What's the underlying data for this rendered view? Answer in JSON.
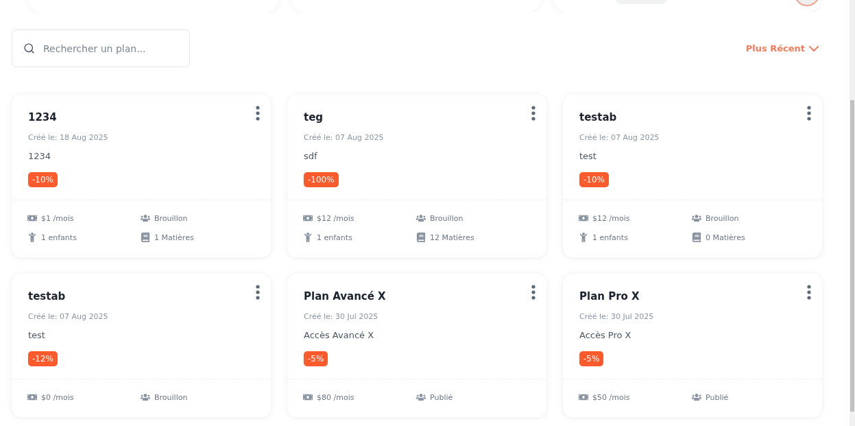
{
  "search": {
    "placeholder": "Rechercher un plan..."
  },
  "sort": {
    "label": "Plus Récent"
  },
  "plans": [
    {
      "title": "1234",
      "created": "Créé le: 18 Aug 2025",
      "description": "1234",
      "discount": "-10%",
      "stats": [
        {
          "kind": "price",
          "text": "$1 /mois"
        },
        {
          "kind": "status",
          "text": "Brouillon"
        },
        {
          "kind": "children",
          "text": "1 enfants"
        },
        {
          "kind": "subjects",
          "text": "1 Matières"
        }
      ]
    },
    {
      "title": "teg",
      "created": "Créé le: 07 Aug 2025",
      "description": "sdf",
      "discount": "-100%",
      "stats": [
        {
          "kind": "price",
          "text": "$12 /mois"
        },
        {
          "kind": "status",
          "text": "Brouillon"
        },
        {
          "kind": "children",
          "text": "1 enfants"
        },
        {
          "kind": "subjects",
          "text": "12 Matières"
        }
      ]
    },
    {
      "title": "testab",
      "created": "Créé le: 07 Aug 2025",
      "description": "test",
      "discount": "-10%",
      "stats": [
        {
          "kind": "price",
          "text": "$12 /mois"
        },
        {
          "kind": "status",
          "text": "Brouillon"
        },
        {
          "kind": "children",
          "text": "1 enfants"
        },
        {
          "kind": "subjects",
          "text": "0 Matières"
        }
      ]
    },
    {
      "title": "testab",
      "created": "Créé le: 07 Aug 2025",
      "description": "test",
      "discount": "-12%",
      "stats": [
        {
          "kind": "price",
          "text": "$0 /mois"
        },
        {
          "kind": "status",
          "text": "Brouillon"
        }
      ]
    },
    {
      "title": "Plan Avancé X",
      "created": "Créé le: 30 Jul 2025",
      "description": "Accès Avancé X",
      "discount": "-5%",
      "stats": [
        {
          "kind": "price",
          "text": "$80 /mois"
        },
        {
          "kind": "status",
          "text": "Publié"
        }
      ]
    },
    {
      "title": "Plan Pro X",
      "created": "Créé le: 30 Jul 2025",
      "description": "Accès Pro X",
      "discount": "-5%",
      "stats": [
        {
          "kind": "price",
          "text": "$50 /mois"
        },
        {
          "kind": "status",
          "text": "Publié"
        }
      ]
    }
  ]
}
